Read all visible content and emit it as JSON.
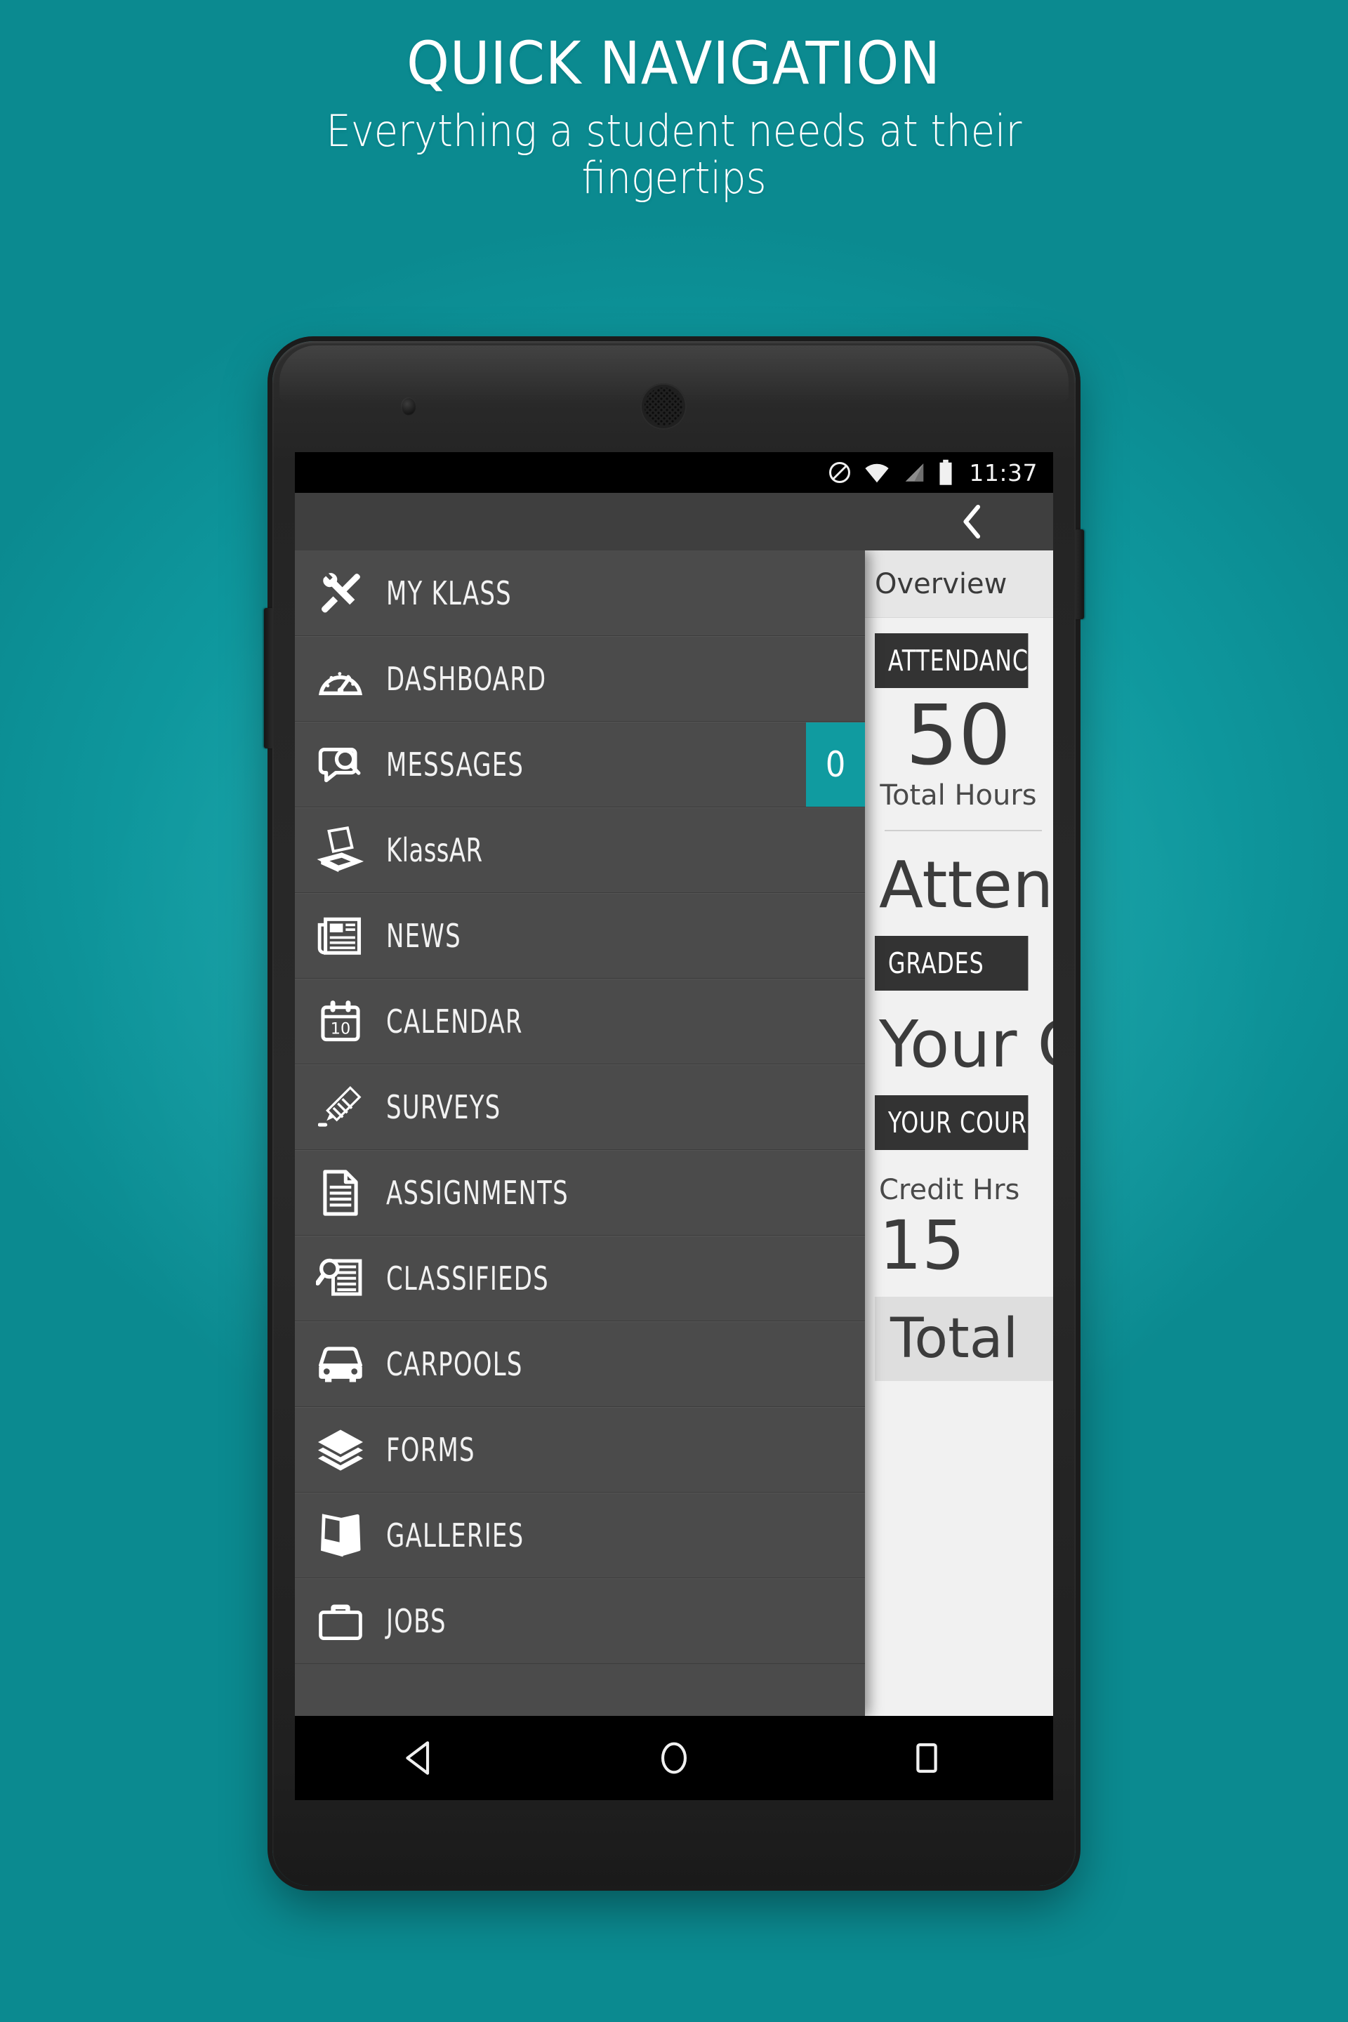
{
  "promo": {
    "title": "QUICK NAVIGATION",
    "subtitle": "Everything a student needs at their fingertips"
  },
  "status_bar": {
    "time": "11:37",
    "icons": [
      "do-not-disturb-icon",
      "wifi-icon",
      "cellular-signal-icon",
      "battery-icon"
    ]
  },
  "action_bar": {
    "back_icon": "chevron-left-icon"
  },
  "drawer": {
    "items": [
      {
        "label": "MY KLASS",
        "icon": "tools-icon",
        "badge": null,
        "style": "upper"
      },
      {
        "label": "DASHBOARD",
        "icon": "gauge-icon",
        "badge": null,
        "style": "upper"
      },
      {
        "label": "MESSAGES",
        "icon": "chat-search-icon",
        "badge": "0",
        "style": "upper"
      },
      {
        "label": "KlassAR",
        "icon": "scanner-icon",
        "badge": null,
        "style": "mixed"
      },
      {
        "label": "NEWS",
        "icon": "newspaper-icon",
        "badge": null,
        "style": "upper"
      },
      {
        "label": "CALENDAR",
        "icon": "calendar-10-icon",
        "badge": null,
        "style": "upper"
      },
      {
        "label": "SURVEYS",
        "icon": "pencil-icon",
        "badge": null,
        "style": "upper"
      },
      {
        "label": "ASSIGNMENTS",
        "icon": "document-icon",
        "badge": null,
        "style": "upper"
      },
      {
        "label": "CLASSIFIEDS",
        "icon": "classifieds-icon",
        "badge": null,
        "style": "upper"
      },
      {
        "label": "CARPOOLS",
        "icon": "car-icon",
        "badge": null,
        "style": "upper"
      },
      {
        "label": "FORMS",
        "icon": "layers-icon",
        "badge": null,
        "style": "upper"
      },
      {
        "label": "GALLERIES",
        "icon": "photos-icon",
        "badge": null,
        "style": "upper"
      },
      {
        "label": "JOBS",
        "icon": "briefcase-icon",
        "badge": null,
        "style": "upper"
      }
    ]
  },
  "overview": {
    "tab_label": "Overview",
    "attendance_header": "ATTENDANCE",
    "attendance_value": "50",
    "attendance_caption": "Total Hours",
    "attendance_headline": "Attendance",
    "grades_header": "GRADES",
    "grades_headline": "Your Grades",
    "courses_header": "YOUR COURSES",
    "credit_hrs_label": "Credit Hrs",
    "credit_hrs_value": "15",
    "total_label": "Total"
  },
  "nav_bar": {
    "keys": [
      "back-key",
      "home-key",
      "recents-key"
    ]
  },
  "colors": {
    "background_teal": "#129ba0",
    "accent_badge": "#109ba0",
    "drawer_bg": "#4b4b4b",
    "content_bg": "#f1f1f1",
    "section_header_bg": "#333333"
  }
}
